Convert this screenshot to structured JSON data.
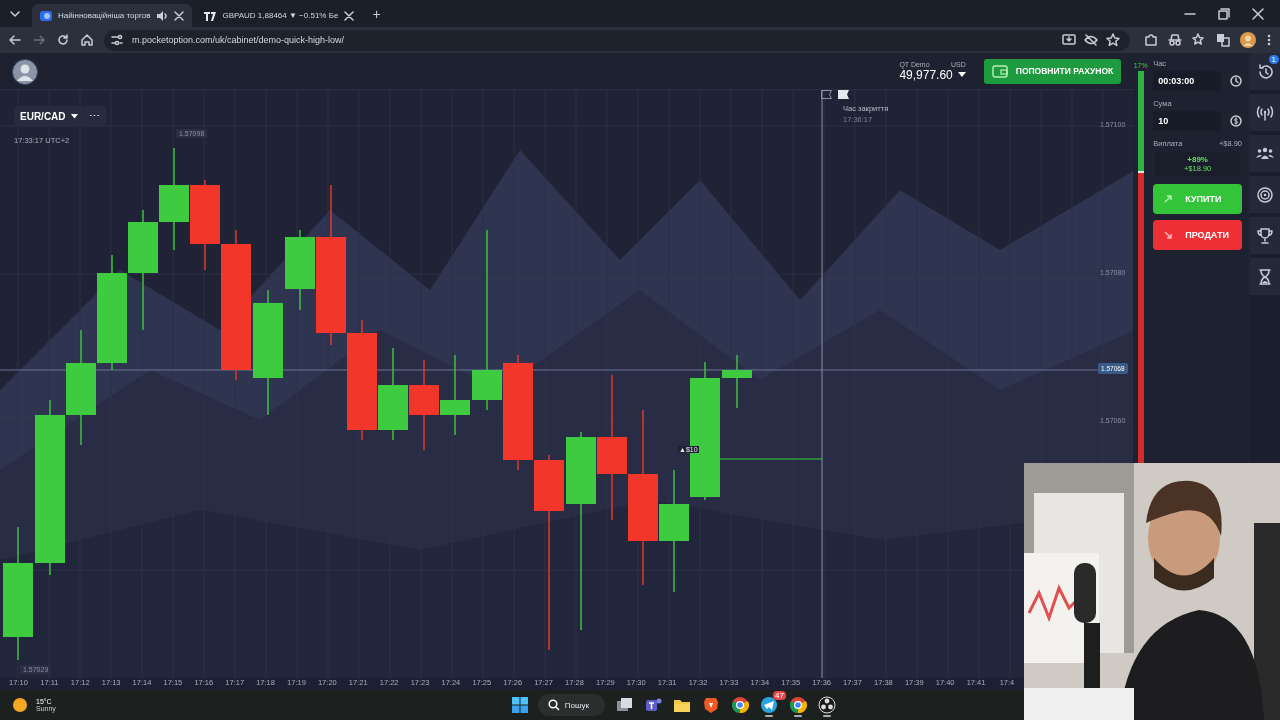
{
  "browser": {
    "tabs": [
      {
        "title": "Найінноваційніша торгов",
        "selected": true,
        "audio": true
      },
      {
        "title": "GBPAUD 1,88464 ▼ −0.51% Бе",
        "selected": false,
        "audio": false
      }
    ],
    "new_tab": "+",
    "address": "m.pocketoption.com/uk/cabinet/demo-quick-high-low/"
  },
  "header": {
    "account_type": "QT Demo",
    "currency": "USD",
    "balance": "49,977.60",
    "deposit_button": "ПОПОВНИТИ РАХУНОК"
  },
  "chart": {
    "symbol": "EUR/CAD",
    "more": "⋯",
    "clock": "17:33:17 UTC+2",
    "high_label": "1.57098",
    "low_label": "1.57029",
    "price_ticks": [
      "1.57100",
      "1.57080",
      "1.57060"
    ],
    "current_price": "1.57068",
    "close_time": {
      "label": "Час закриття",
      "time": "17:36:17"
    },
    "trade_marker": "▲$10",
    "time_ticks": [
      "17:10",
      "17:11",
      "17:12",
      "17:13",
      "17:14",
      "17:15",
      "17:16",
      "17:17",
      "17:18",
      "17:19",
      "17:20",
      "17:21",
      "17:22",
      "17:23",
      "17:24",
      "17:25",
      "17:26",
      "17:27",
      "17:28",
      "17:29",
      "17:30",
      "17:31",
      "17:32",
      "17:33",
      "17:34",
      "17:35",
      "17:36",
      "17:37",
      "17:38",
      "17:39",
      "17:40",
      "17:41",
      "17:4"
    ]
  },
  "sentiment": {
    "label": "17%",
    "level": 0.26
  },
  "trade_panel": {
    "time": {
      "label": "Час",
      "value": "00:03:00"
    },
    "amount": {
      "label": "Сума",
      "value": "10"
    },
    "payout": {
      "label": "Виплата",
      "value": "+$8.90",
      "percent": "+89%",
      "profit": "+$18.90"
    },
    "buy_button": "КУПИТИ",
    "sell_button": "ПРОДАТИ"
  },
  "side_icons": [
    {
      "kind": "history",
      "badge": "1"
    },
    {
      "kind": "signals"
    },
    {
      "kind": "social"
    },
    {
      "kind": "target"
    },
    {
      "kind": "trophy"
    },
    {
      "kind": "hourglass"
    }
  ],
  "taskbar": {
    "weather": {
      "temperature": "15°C",
      "condition": "Sunny"
    },
    "search": "Пошук",
    "apps": [
      {
        "kind": "taskview",
        "running": false
      },
      {
        "kind": "teams",
        "running": false
      },
      {
        "kind": "files",
        "running": false
      },
      {
        "kind": "brave",
        "running": false
      },
      {
        "kind": "chrome",
        "running": false
      },
      {
        "kind": "telegram",
        "badge": "47",
        "running": true
      },
      {
        "kind": "chrome",
        "running": true
      },
      {
        "kind": "obs",
        "running": true
      }
    ]
  }
}
